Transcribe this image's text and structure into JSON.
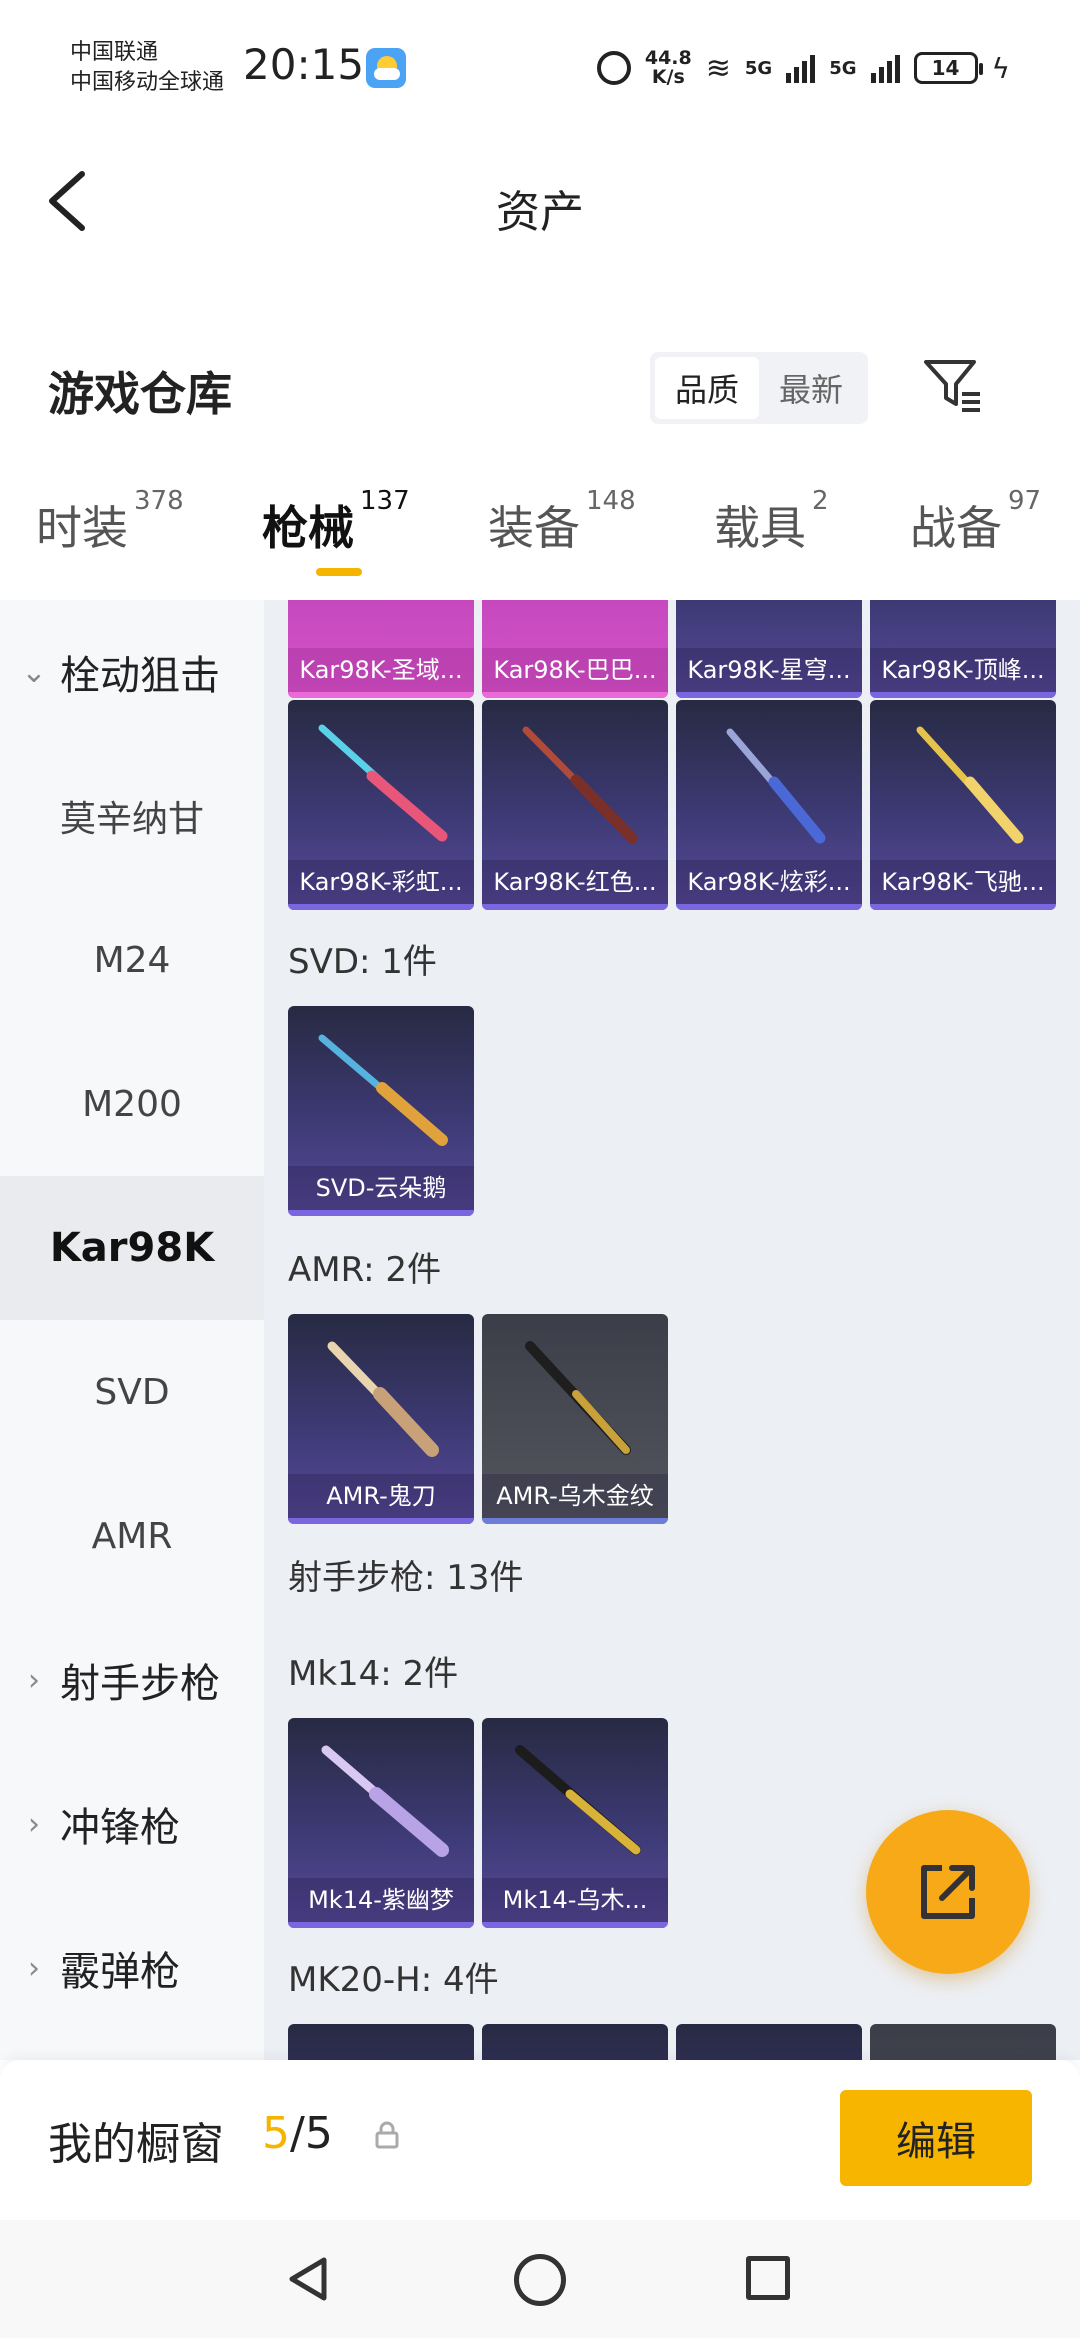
{
  "status_bar": {
    "carrier_1": "中国联通",
    "carrier_2": "中国移动全球通",
    "time": "20:15",
    "net_speed_value": "44.8",
    "net_speed_unit": "K/s",
    "network_1": "5G",
    "network_2": "5G",
    "battery": "14"
  },
  "header": {
    "title": "资产"
  },
  "warehouse": {
    "title": "游戏仓库",
    "sort_options": [
      "品质",
      "最新"
    ],
    "active_sort": "品质"
  },
  "category_tabs": [
    {
      "label": "时装",
      "count": "378"
    },
    {
      "label": "枪械",
      "count": "137",
      "active": true
    },
    {
      "label": "装备",
      "count": "148"
    },
    {
      "label": "载具",
      "count": "2"
    },
    {
      "label": "战备",
      "count": "97"
    }
  ],
  "sidebar": {
    "items": [
      {
        "label": "栓动狙击",
        "type": "group-expanded"
      },
      {
        "label": "莫辛纳甘",
        "type": "item"
      },
      {
        "label": "M24",
        "type": "item"
      },
      {
        "label": "M200",
        "type": "item"
      },
      {
        "label": "Kar98K",
        "type": "item",
        "active": true
      },
      {
        "label": "SVD",
        "type": "item"
      },
      {
        "label": "AMR",
        "type": "item"
      },
      {
        "label": "射手步枪",
        "type": "group-collapsed"
      },
      {
        "label": "冲锋枪",
        "type": "group-collapsed"
      },
      {
        "label": "霰弹枪",
        "type": "group-collapsed"
      }
    ]
  },
  "content": {
    "kar98k_row1": [
      "Kar98K-圣域...",
      "Kar98K-巴巴...",
      "Kar98K-星穹...",
      "Kar98K-顶峰..."
    ],
    "kar98k_row2": [
      "Kar98K-彩虹...",
      "Kar98K-红色...",
      "Kar98K-炫彩...",
      "Kar98K-飞驰..."
    ],
    "svd_title": "SVD: 1件",
    "svd_items": [
      "SVD-云朵鹅"
    ],
    "amr_title": "AMR: 2件",
    "amr_items": [
      "AMR-鬼刀",
      "AMR-乌木金纹"
    ],
    "dmr_title": "射手步枪: 13件",
    "mk14_title": "Mk14: 2件",
    "mk14_items": [
      "Mk14-紫幽梦",
      "Mk14-乌木..."
    ],
    "mk20_title": "MK20-H: 4件"
  },
  "showcase": {
    "label": "我的橱窗",
    "current": "5",
    "total": "/5",
    "edit_label": "编辑"
  },
  "colors": {
    "accent": "#f5b400",
    "fab": "#f7a918",
    "card_purple": "#3d3a75",
    "card_pink": "#d555c8"
  }
}
